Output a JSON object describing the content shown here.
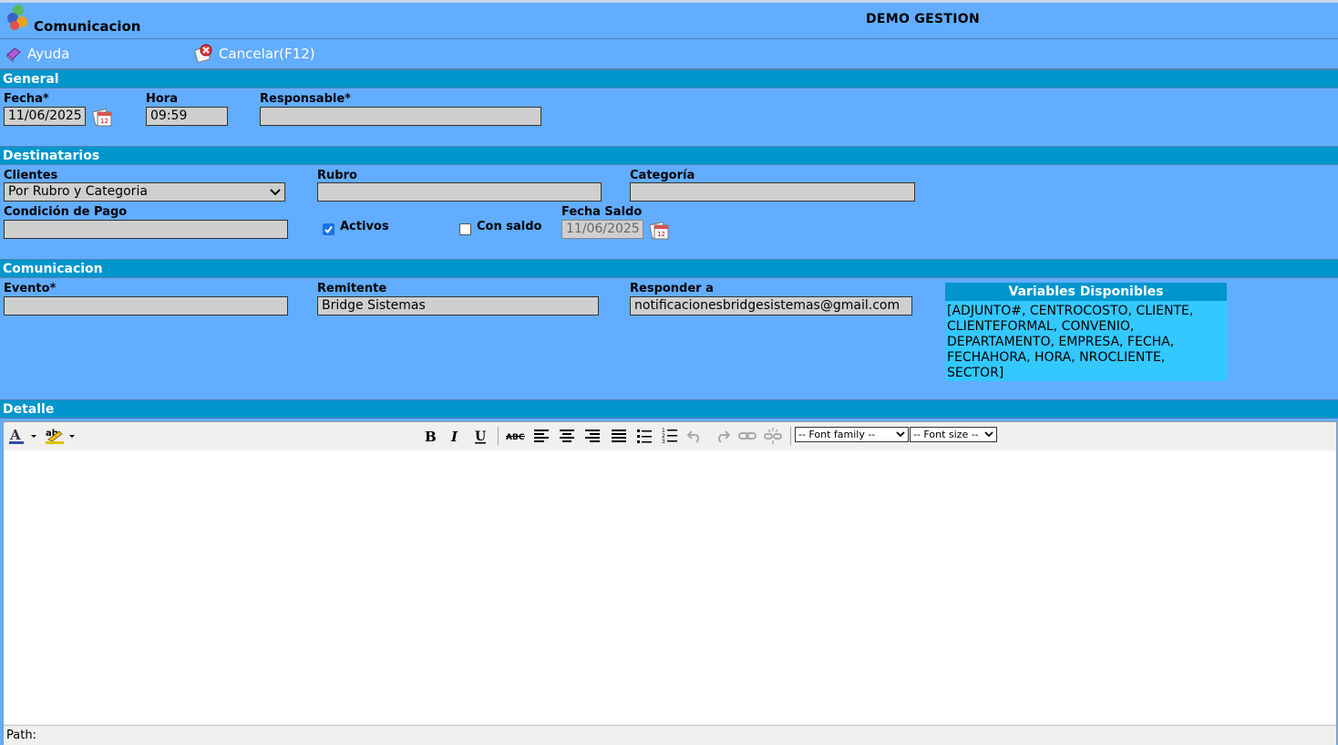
{
  "window": {
    "title": "Comunicacion",
    "company": "DEMO GESTION"
  },
  "toolbar": {
    "help_label": "Ayuda",
    "cancel_label": "Cancelar(F12)"
  },
  "sections": {
    "general": "General",
    "destinatarios": "Destinatarios",
    "comunicacion": "Comunicacion",
    "detalle": "Detalle"
  },
  "general": {
    "fecha_label": "Fecha*",
    "fecha_value": "11/06/2025",
    "hora_label": "Hora",
    "hora_value": "09:59",
    "responsable_label": "Responsable*",
    "responsable_value": ""
  },
  "destinatarios": {
    "clientes_label": "Clientes",
    "clientes_value": "Por Rubro y Categoria",
    "rubro_label": "Rubro",
    "rubro_value": "",
    "categoria_label": "Categoría",
    "categoria_value": "",
    "condicion_label": "Condición de Pago",
    "condicion_value": "",
    "activos_label": "Activos",
    "activos_checked": true,
    "con_saldo_label": "Con saldo",
    "con_saldo_checked": false,
    "fecha_saldo_label": "Fecha Saldo",
    "fecha_saldo_value": "11/06/2025"
  },
  "comunicacion": {
    "evento_label": "Evento*",
    "evento_value": "",
    "remitente_label": "Remitente",
    "remitente_value": "Bridge Sistemas",
    "responder_label": "Responder a",
    "responder_value": "notificacionesbridgesistemas@gmail.com",
    "variables_title": "Variables Disponibles",
    "variables_text": "[ADJUNTO#, CENTROCOSTO, CLIENTE, CLIENTEFORMAL, CONVENIO, DEPARTAMENTO, EMPRESA, FECHA, FECHAHORA, HORA, NROCLIENTE, SECTOR]"
  },
  "editor": {
    "font_family": "-- Font family --",
    "font_size": "-- Font size --",
    "path_label": "Path:",
    "icons": [
      "text-color-icon",
      "highlight-color-icon",
      "bold-icon",
      "italic-icon",
      "underline-icon",
      "strikethrough-icon",
      "align-left-icon",
      "align-center-icon",
      "align-right-icon",
      "align-justify-icon",
      "bullet-list-icon",
      "numbered-list-icon",
      "undo-icon",
      "redo-icon",
      "link-icon",
      "unlink-icon"
    ]
  },
  "colors": {
    "background": "#62adff",
    "section_header": "#0096cc",
    "variables_box": "#33c8ff",
    "field": "#cfcfcf"
  }
}
